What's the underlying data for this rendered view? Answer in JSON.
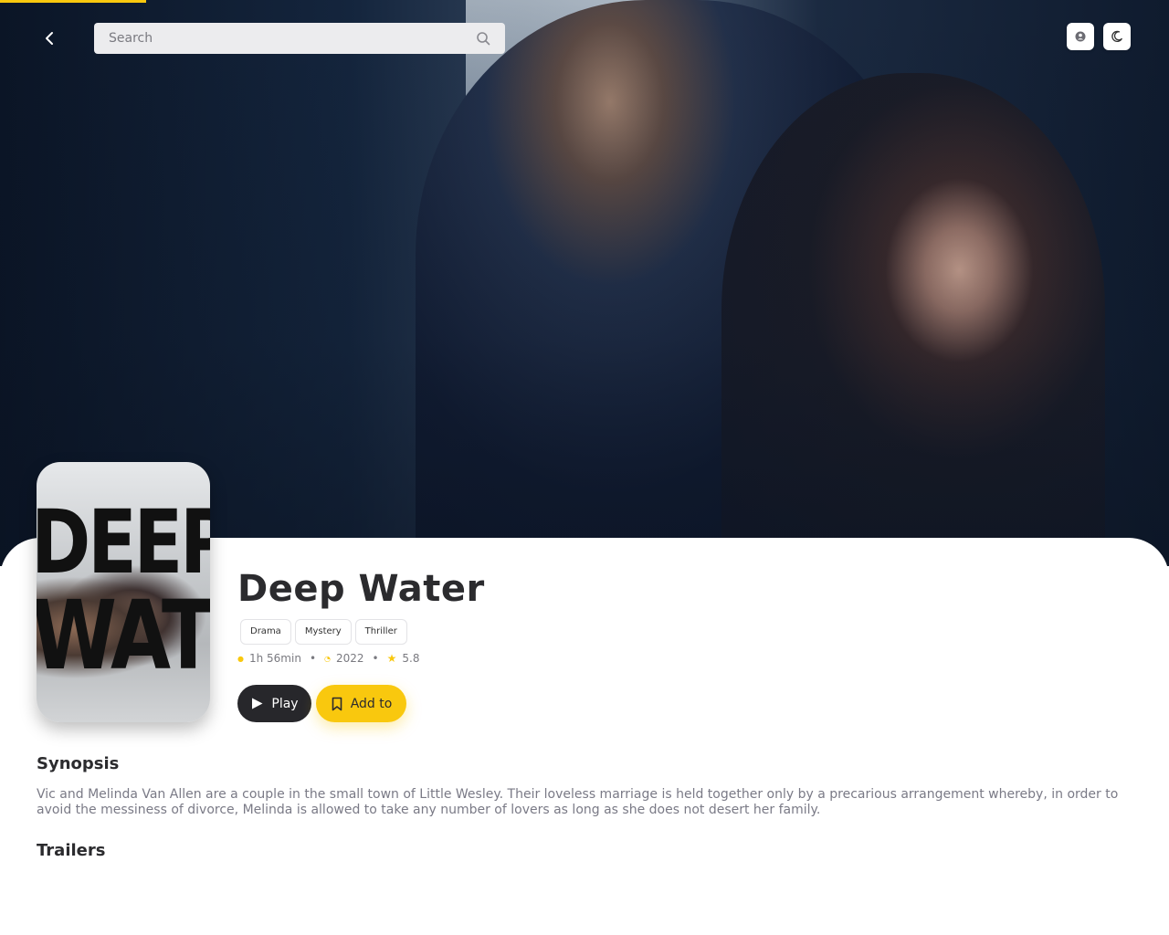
{
  "colors": {
    "accent": "#f9c80e",
    "dark_button": "#27272b",
    "text_primary": "#2b2b2e",
    "text_muted": "#7a7a80"
  },
  "page_progress": 0.125,
  "header": {
    "back_icon": "chevron-left-icon",
    "search": {
      "placeholder": "Search",
      "value": "",
      "icon": "search-icon"
    },
    "profile_icon": "user-circle-icon",
    "theme_icon": "moon-icon"
  },
  "movie": {
    "poster_text_line1": "DEEP",
    "poster_text_line2": "WATER",
    "title": "Deep Water",
    "genres": [
      "Drama",
      "Mystery",
      "Thriller"
    ],
    "duration": "1h 56min",
    "year": "2022",
    "rating": "5.8",
    "separator": "•"
  },
  "actions": {
    "play_label": "Play",
    "add_label": "Add to"
  },
  "sections": {
    "synopsis_title": "Synopsis",
    "synopsis_text": "Vic and Melinda Van Allen are a couple in the small town of Little Wesley. Their loveless marriage is held together only by a precarious arrangement whereby, in order to avoid the messiness of divorce, Melinda is allowed to take any number of lovers as long as she does not desert her family.",
    "trailers_title": "Trailers"
  }
}
